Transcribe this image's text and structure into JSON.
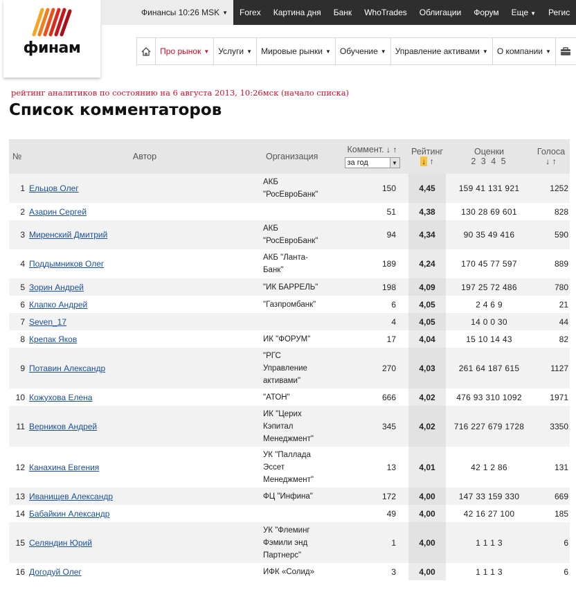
{
  "logo": {
    "text": "финам"
  },
  "topbar": {
    "finance_tab": "Финансы  10:26 MSK",
    "items": [
      "Forex",
      "Картина дня",
      "Банк",
      "WhoTrades",
      "Облигации",
      "Форум",
      "Еще",
      "Регис"
    ]
  },
  "subnav": {
    "items": [
      "Про рынок",
      "Услуги",
      "Мировые рынки",
      "Обучение",
      "Управление активами",
      "О компании"
    ]
  },
  "rating_note": "рейтинг аналитиков по состоянию на 6 августа 2013, 10:26мск (начало списка)",
  "page_title": "Список комментаторов",
  "table": {
    "headers": {
      "num": "№",
      "author": "Автор",
      "org": "Организация",
      "comments": "Коммент.",
      "period": "за год",
      "rating": "Рейтинг",
      "scores": "Оценки",
      "scores_sub": "2 3 4 5",
      "votes": "Голоса"
    },
    "rows": [
      {
        "n": "1",
        "author": "Ельцов Олег",
        "org": [
          "АКБ",
          "\"РосЕвроБанк\""
        ],
        "comments": "150",
        "rating": "4,45",
        "scores": "159 41 131 921",
        "votes": "1252"
      },
      {
        "n": "2",
        "author": "Азарин Сергей",
        "org": [],
        "comments": "51",
        "rating": "4,38",
        "scores": "130 28 69 601",
        "votes": "828"
      },
      {
        "n": "3",
        "author": "Миренский Дмитрий",
        "org": [
          "АКБ",
          "\"РосЕвроБанк\""
        ],
        "comments": "94",
        "rating": "4,34",
        "scores": "90 35 49 416",
        "votes": "590"
      },
      {
        "n": "4",
        "author": "Поддымников Олег",
        "org": [
          "АКБ \"Ланта-",
          "Банк\""
        ],
        "comments": "189",
        "rating": "4,24",
        "scores": "170 45 77 597",
        "votes": "889"
      },
      {
        "n": "5",
        "author": "Зорин Андрей",
        "org": [
          "\"ИК БАРРЕЛЬ\""
        ],
        "comments": "198",
        "rating": "4,09",
        "scores": "197 25 72 486",
        "votes": "780"
      },
      {
        "n": "6",
        "author": "Клапко Андрей",
        "org": [
          "\"Газпромбанк\""
        ],
        "comments": "6",
        "rating": "4,05",
        "scores": "2 4 6 9",
        "votes": "21"
      },
      {
        "n": "7",
        "author": "Seven_17",
        "org": [],
        "comments": "4",
        "rating": "4,05",
        "scores": "14 0 0 30",
        "votes": "44"
      },
      {
        "n": "8",
        "author": "Крепак Яков",
        "org": [
          "ИК \"ФОРУМ\""
        ],
        "comments": "17",
        "rating": "4,04",
        "scores": "15 10 14 43",
        "votes": "82"
      },
      {
        "n": "9",
        "author": "Потавин Александр",
        "org": [
          "\"РГС",
          "Управление",
          "активами\""
        ],
        "comments": "270",
        "rating": "4,03",
        "scores": "261 64 187 615",
        "votes": "1127"
      },
      {
        "n": "10",
        "author": "Кожухова Елена",
        "org": [
          "\"АТОН\""
        ],
        "comments": "666",
        "rating": "4,02",
        "scores": "476 93 310 1092",
        "votes": "1971"
      },
      {
        "n": "11",
        "author": "Верников Андрей",
        "org": [
          "ИК \"Церих",
          "Кэпитал",
          "Менеджмент\""
        ],
        "comments": "345",
        "rating": "4,02",
        "scores": "716 227 679 1728",
        "votes": "3350"
      },
      {
        "n": "12",
        "author": "Канахина Евгения",
        "org": [
          "УК \"Паллада",
          "Эссет",
          "Менеджмент\""
        ],
        "comments": "13",
        "rating": "4,01",
        "scores": "42 1 2 86",
        "votes": "131"
      },
      {
        "n": "13",
        "author": "Иванищев Александр",
        "org": [
          "ФЦ \"Инфина\""
        ],
        "comments": "172",
        "rating": "4,00",
        "scores": "147 33 159 330",
        "votes": "669"
      },
      {
        "n": "14",
        "author": "Бабайкин Александр",
        "org": [],
        "comments": "49",
        "rating": "4,00",
        "scores": "42 16 27 100",
        "votes": "185"
      },
      {
        "n": "15",
        "author": "Селяндин Юрий",
        "org": [
          "УК \"Флеминг",
          "Фэмили энд",
          "Партнерс\""
        ],
        "comments": "1",
        "rating": "4,00",
        "scores": "1 1 1 3",
        "votes": "6"
      },
      {
        "n": "16",
        "author": "Догодуй Олег",
        "org": [
          "ИФК «Солид»"
        ],
        "comments": "3",
        "rating": "4,00",
        "scores": "1 1 1 3",
        "votes": "6"
      }
    ]
  },
  "icons": {
    "home": "home-icon",
    "bag": "briefcase-icon",
    "sort_down": "sort-down-arrow-icon",
    "sort_up": "sort-up-arrow-icon",
    "dropdown": "chevron-down-icon"
  },
  "colors": {
    "accent_red": "#c8102e",
    "link_blue": "#1a4f9c",
    "topbar_bg": "#2e2e2e",
    "highlight": "#f5c542"
  }
}
